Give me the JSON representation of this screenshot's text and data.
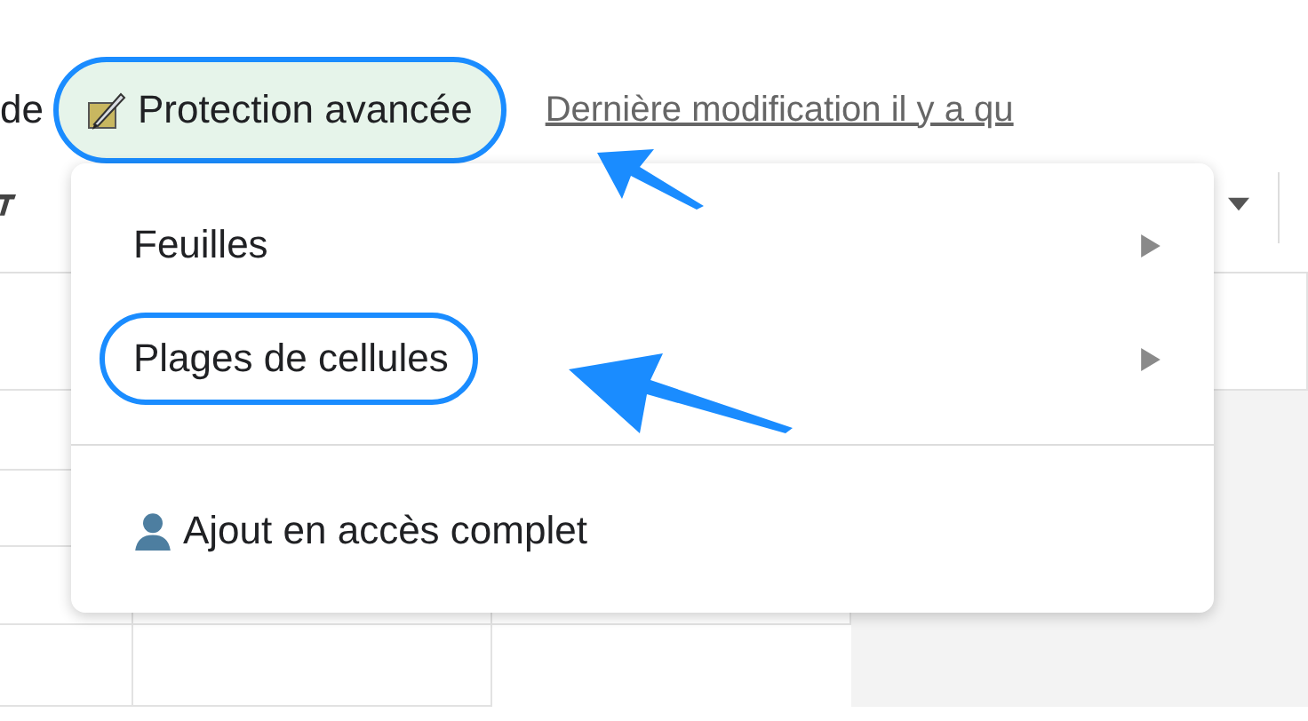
{
  "header": {
    "prefix": "de",
    "protection_button": {
      "label": "Protection avancée",
      "annotated": true
    },
    "last_edit_link": "Dernière modification il y a qu"
  },
  "menu": {
    "items": [
      {
        "label": "Feuilles",
        "has_submenu": true,
        "annotated": false,
        "divider_before": false,
        "kind": "plain"
      },
      {
        "label": "Plages de cellules",
        "has_submenu": true,
        "annotated": true,
        "divider_before": false,
        "kind": "plain"
      },
      {
        "label": "Ajout en accès complet",
        "has_submenu": false,
        "annotated": false,
        "divider_before": true,
        "kind": "person"
      }
    ]
  }
}
